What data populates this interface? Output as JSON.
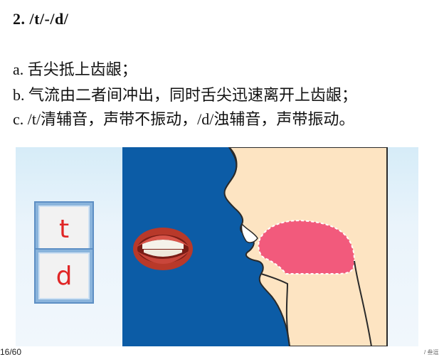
{
  "slide": {
    "title": "2. /t/-/d/",
    "lines": [
      "a. 舌尖抵上齿龈；",
      "b. 气流由二者间冲出，同时舌尖迅速离开上齿龈；",
      "c. /t/清辅音，声带不振动，/d/浊辅音，声带振动。"
    ]
  },
  "cards": [
    "t",
    "d"
  ],
  "footer": {
    "page": "16/60",
    "mark": "/ 叁逗"
  },
  "colors": {
    "diagram_bg": "#0c5ca6",
    "skin": "#fde4c2",
    "tongue": "#f25a7c",
    "letter": "#e02626"
  }
}
